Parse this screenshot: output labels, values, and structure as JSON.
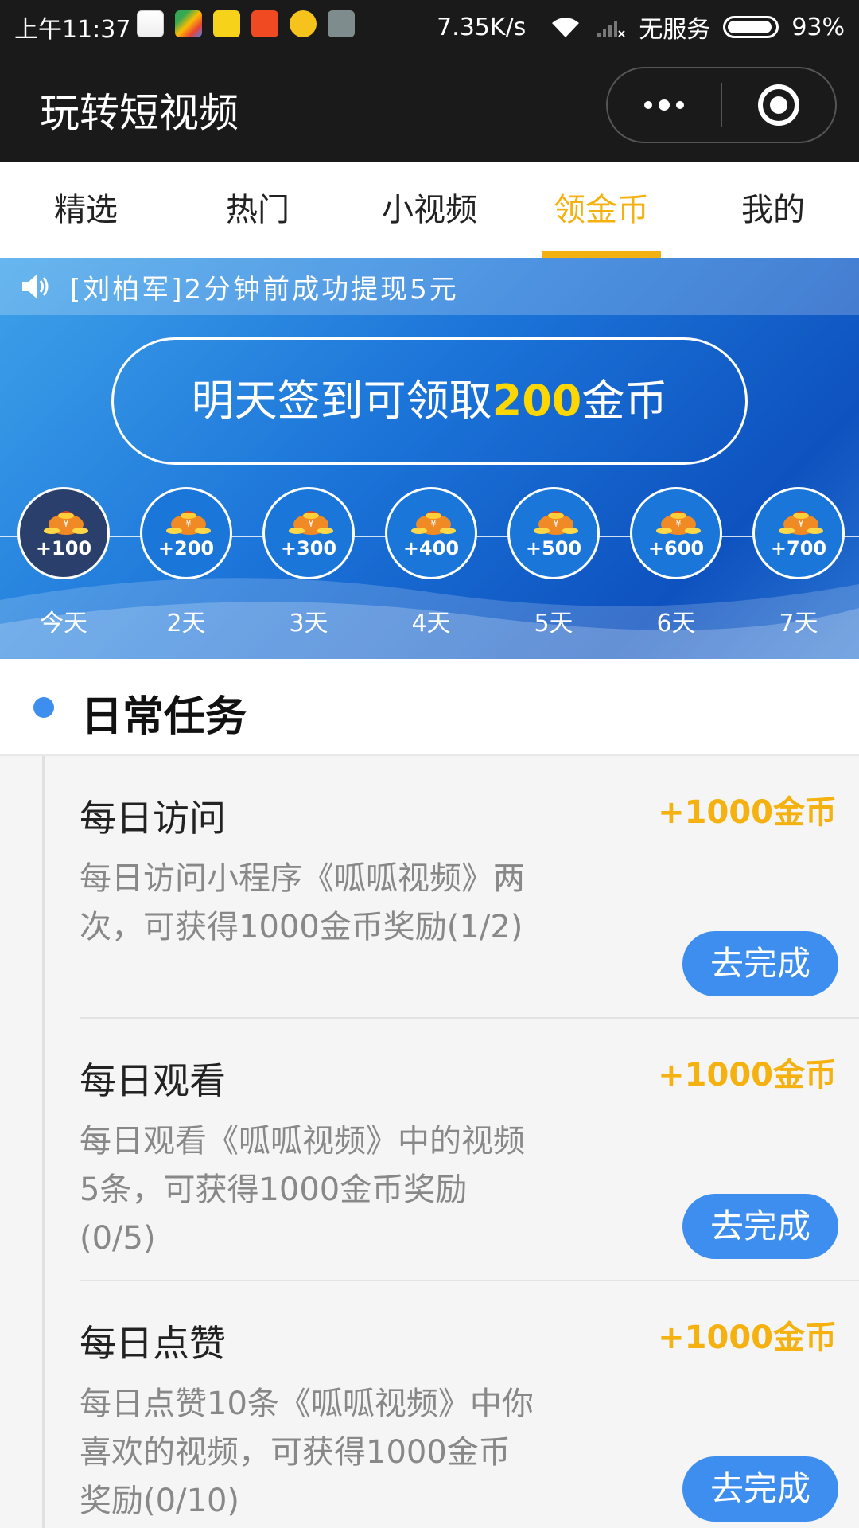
{
  "status_bar": {
    "time": "上午11:37",
    "net_speed": "7.35K/s",
    "carrier": "无服务",
    "battery": "93%",
    "app_icons": [
      "maps-app-icon",
      "play-store-icon",
      "news-app-icon",
      "video-app-icon",
      "weibo-icon",
      "notes-app-icon"
    ]
  },
  "title_bar": {
    "title": "玩转短视频"
  },
  "tabs": [
    {
      "label": "精选",
      "active": false
    },
    {
      "label": "热门",
      "active": false
    },
    {
      "label": "小视频",
      "active": false
    },
    {
      "label": "领金币",
      "active": true
    },
    {
      "label": "我的",
      "active": false
    }
  ],
  "banner": {
    "notice": "[刘柏军]2分钟前成功提现5元",
    "sign_prefix": "明天签到可领取",
    "sign_amount": "200",
    "sign_suffix": "金币",
    "days": [
      {
        "amount": "+100",
        "label": "今天",
        "today": true
      },
      {
        "amount": "+200",
        "label": "2天",
        "today": false
      },
      {
        "amount": "+300",
        "label": "3天",
        "today": false
      },
      {
        "amount": "+400",
        "label": "4天",
        "today": false
      },
      {
        "amount": "+500",
        "label": "5天",
        "today": false
      },
      {
        "amount": "+600",
        "label": "6天",
        "today": false
      },
      {
        "amount": "+700",
        "label": "7天",
        "today": false
      }
    ]
  },
  "tasks_section": {
    "title": "日常任务",
    "tasks": [
      {
        "name": "每日访问",
        "reward": "+1000金币",
        "desc": "每日访问小程序《呱呱视频》两次，可获得1000金币奖励(1/2)",
        "button": "去完成"
      },
      {
        "name": "每日观看",
        "reward": "+1000金币",
        "desc": "每日观看《呱呱视频》中的视频5条，可获得1000金币奖励(0/5)",
        "button": "去完成"
      },
      {
        "name": "每日点赞",
        "reward": "+1000金币",
        "desc": "每日点赞10条《呱呱视频》中你喜欢的视频，可获得1000金币奖励(0/10)",
        "button": "去完成"
      }
    ]
  },
  "colors": {
    "accent": "#f4b10f",
    "button": "#3d8eef",
    "header": "#1a1a1a"
  }
}
